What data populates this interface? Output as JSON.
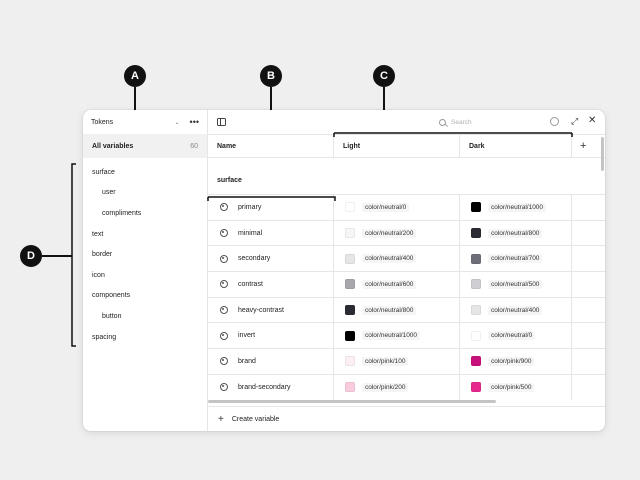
{
  "sidebar": {
    "collection": "Tokens",
    "all_variables_label": "All variables",
    "all_variables_count": "60",
    "groups": [
      {
        "label": "surface"
      },
      {
        "label": "user"
      },
      {
        "label": "compliments"
      },
      {
        "label": "text"
      },
      {
        "label": "border"
      },
      {
        "label": "icon"
      },
      {
        "label": "components"
      },
      {
        "label": "button"
      },
      {
        "label": "spacing"
      }
    ]
  },
  "toolbar": {
    "search_placeholder": "Search"
  },
  "table": {
    "columns": {
      "name": "Name",
      "light": "Light",
      "dark": "Dark"
    },
    "group_label": "surface",
    "rows": [
      {
        "name": "primary",
        "light": "color/neutral/0",
        "light_color": "#ffffff",
        "dark": "color/neutral/1000",
        "dark_color": "#000000"
      },
      {
        "name": "minimal",
        "light": "color/neutral/200",
        "light_color": "#f6f6f6",
        "dark": "color/neutral/800",
        "dark_color": "#2b2b33"
      },
      {
        "name": "secondary",
        "light": "color/neutral/400",
        "light_color": "#e6e6e6",
        "dark": "color/neutral/700",
        "dark_color": "#6e6e78"
      },
      {
        "name": "contrast",
        "light": "color/neutral/600",
        "light_color": "#a8a8ad",
        "dark": "color/neutral/500",
        "dark_color": "#cfcfd3"
      },
      {
        "name": "heavy-contrast",
        "light": "color/neutral/800",
        "light_color": "#2b2b33",
        "dark": "color/neutral/400",
        "dark_color": "#e6e6e6"
      },
      {
        "name": "invert",
        "light": "color/neutral/1000",
        "light_color": "#000000",
        "dark": "color/neutral/0",
        "dark_color": "#ffffff"
      },
      {
        "name": "brand",
        "light": "color/pink/100",
        "light_color": "#fdf0f5",
        "dark": "color/pink/900",
        "dark_color": "#c8107c"
      },
      {
        "name": "brand-secondary",
        "light": "color/pink/200",
        "light_color": "#f8ccde",
        "dark": "color/pink/500",
        "dark_color": "#e8288c"
      }
    ]
  },
  "footer": {
    "create_label": "Create variable"
  },
  "callouts": {
    "a": "A",
    "b": "B",
    "c": "C",
    "d": "D"
  }
}
